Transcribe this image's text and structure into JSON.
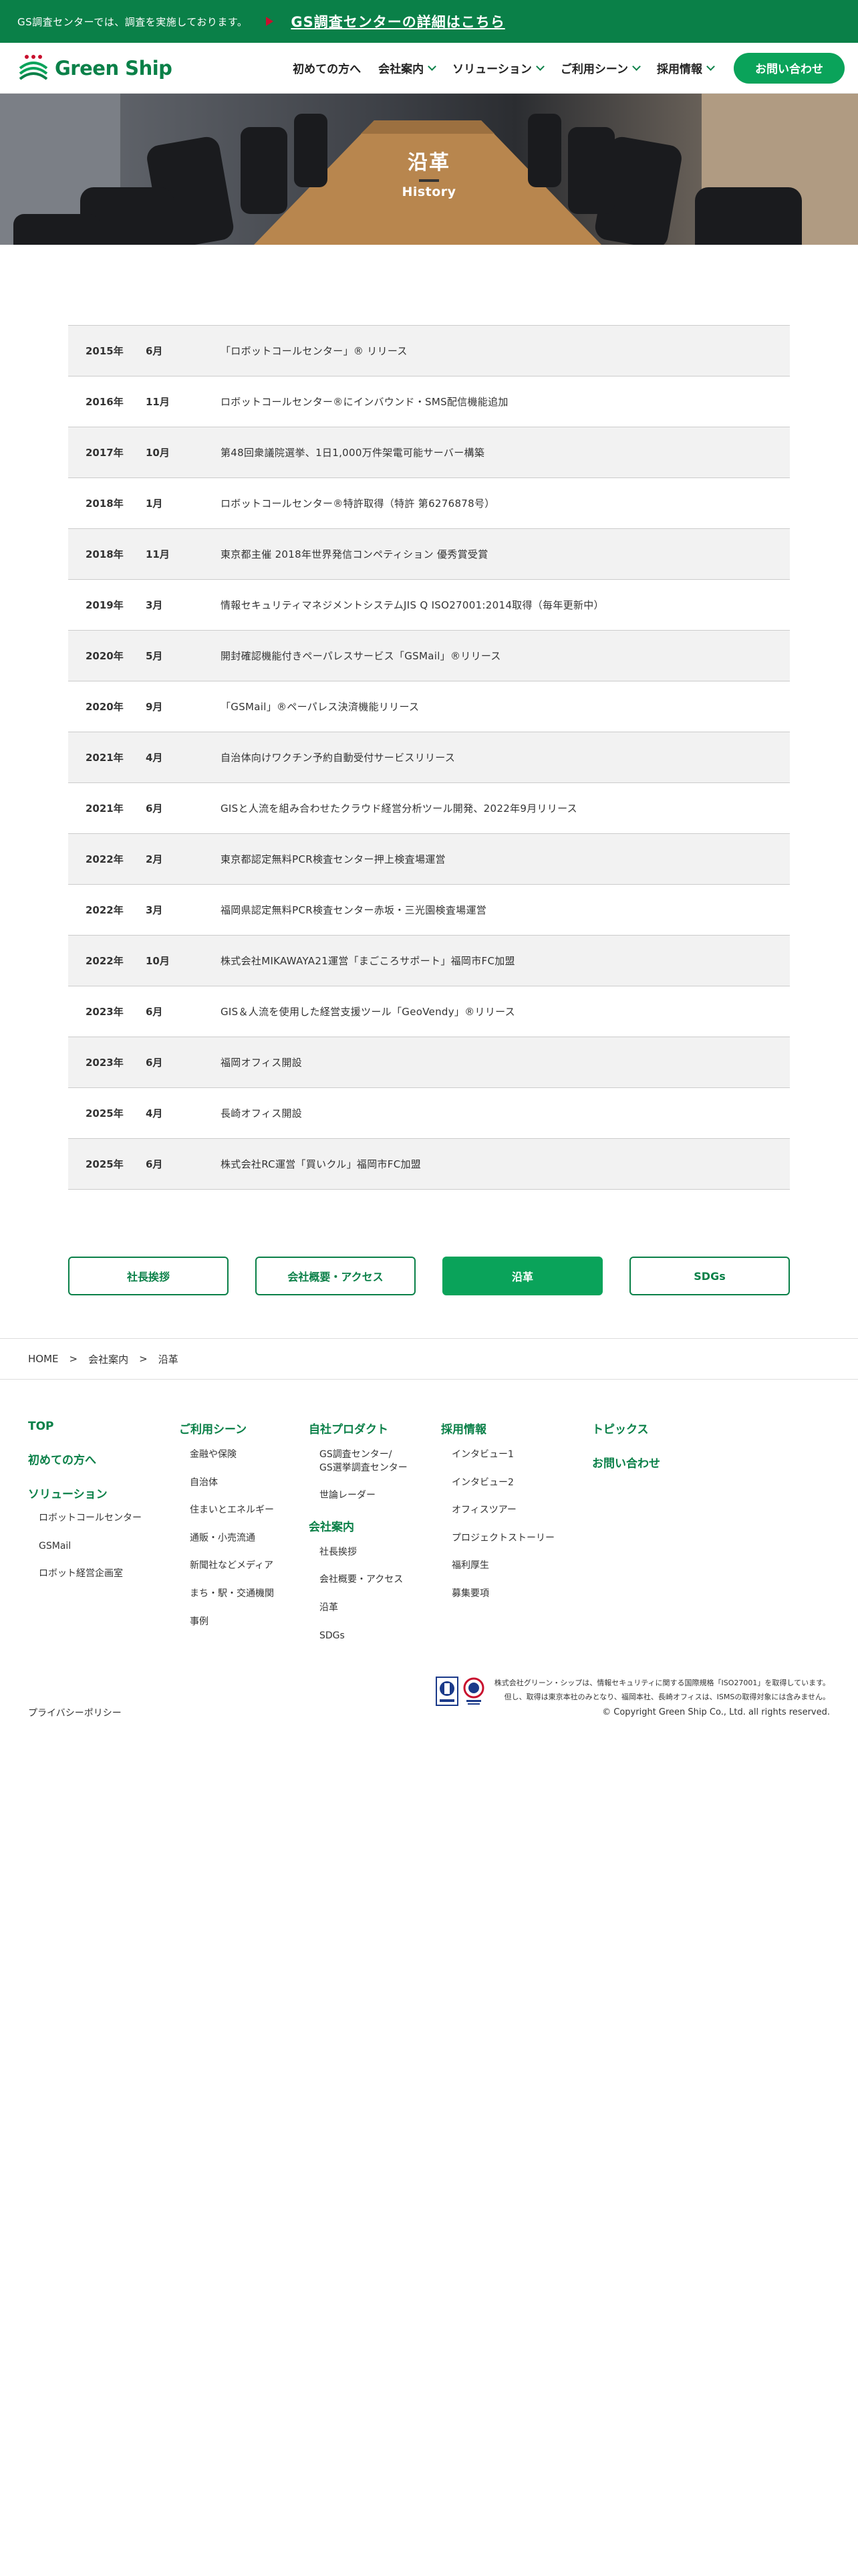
{
  "topbar": {
    "notice": "GS調査センターでは、調査を実施しております。",
    "link": "GS調査センターの詳細はこちら"
  },
  "header": {
    "logo_text": "Green Ship",
    "nav": [
      "初めての方へ",
      "会社案内",
      "ソリューション",
      "ご利用シーン",
      "採用情報"
    ],
    "contact": "お問い合わせ"
  },
  "hero": {
    "title": "沿革",
    "subtitle": "History"
  },
  "history": [
    {
      "year": "2015年",
      "month": "6月",
      "text": "「ロボットコールセンター」® リリース"
    },
    {
      "year": "2016年",
      "month": "11月",
      "text": "ロボットコールセンター®にインバウンド・SMS配信機能追加"
    },
    {
      "year": "2017年",
      "month": "10月",
      "text": "第48回衆議院選挙、1日1,000万件架電可能サーバー構築"
    },
    {
      "year": "2018年",
      "month": "1月",
      "text": "ロボットコールセンター®特許取得（特許 第6276878号）"
    },
    {
      "year": "2018年",
      "month": "11月",
      "text": "東京都主催 2018年世界発信コンペティション 優秀賞受賞"
    },
    {
      "year": "2019年",
      "month": "3月",
      "text": "情報セキュリティマネジメントシステムJIS Q ISO27001:2014取得（毎年更新中）"
    },
    {
      "year": "2020年",
      "month": "5月",
      "text": "開封確認機能付きペーパレスサービス「GSMail」®リリース"
    },
    {
      "year": "2020年",
      "month": "9月",
      "text": "「GSMail」®ペーパレス決済機能リリース"
    },
    {
      "year": "2021年",
      "month": "4月",
      "text": "自治体向けワクチン予約自動受付サービスリリース"
    },
    {
      "year": "2021年",
      "month": "6月",
      "text": "GISと人流を組み合わせたクラウド経営分析ツール開発、2022年9月リリース"
    },
    {
      "year": "2022年",
      "month": "2月",
      "text": "東京都認定無料PCR検査センター押上検査場運営"
    },
    {
      "year": "2022年",
      "month": "3月",
      "text": "福岡県認定無料PCR検査センター赤坂・三光園検査場運営"
    },
    {
      "year": "2022年",
      "month": "10月",
      "text": "株式会社MIKAWAYA21運営「まごころサポート」福岡市FC加盟"
    },
    {
      "year": "2023年",
      "month": "6月",
      "text": "GIS＆人流を使用した経営支援ツール「GeoVendy」®リリース"
    },
    {
      "year": "2023年",
      "month": "6月",
      "text": "福岡オフィス開設"
    },
    {
      "year": "2025年",
      "month": "4月",
      "text": "長崎オフィス開設"
    },
    {
      "year": "2025年",
      "month": "6月",
      "text": "株式会社RC運営「買いクル」福岡市FC加盟"
    }
  ],
  "subnav": [
    "社長挨拶",
    "会社概要・アクセス",
    "沿革",
    "SDGs"
  ],
  "breadcrumb": [
    "HOME",
    ">",
    "会社案内",
    ">",
    "沿革"
  ],
  "footer": {
    "col1": {
      "top": "TOP",
      "first": "初めての方へ",
      "solution": "ソリューション",
      "items": [
        "ロボットコールセンター",
        "GSMail",
        "ロボット経営企画室"
      ]
    },
    "col2": {
      "heading": "ご利用シーン",
      "items": [
        "金融や保険",
        "自治体",
        "住まいとエネルギー",
        "通販・小売流通",
        "新聞社などメディア",
        "まち・駅・交通機関",
        "事例"
      ]
    },
    "col3": {
      "heading": "自社プロダクト",
      "product1": "GS調査センター/",
      "product2": "GS選挙調査センター",
      "product3": "世論レーダー",
      "heading2": "会社案内",
      "items": [
        "社長挨拶",
        "会社概要・アクセス",
        "沿革",
        "SDGs"
      ]
    },
    "col4": {
      "heading": "採用情報",
      "items": [
        "インタビュー1",
        "インタビュー2",
        "オフィスツアー",
        "プロジェクトストーリー",
        "福利厚生",
        "募集要項"
      ]
    },
    "col5": {
      "topics": "トピックス",
      "contact": "お問い合わせ"
    },
    "privacy": "プライバシーポリシー",
    "cert_note1": "株式会社グリーン・シップは、情報セキュリティに関する国際規格「ISO27001」を取得しています。",
    "cert_note2": "但し、取得は東京本社のみとなり、福岡本社、長崎オフィスは、ISMSの取得対象には含みません。",
    "copyright": "© Copyright Green Ship Co., Ltd. all rights reserved."
  }
}
